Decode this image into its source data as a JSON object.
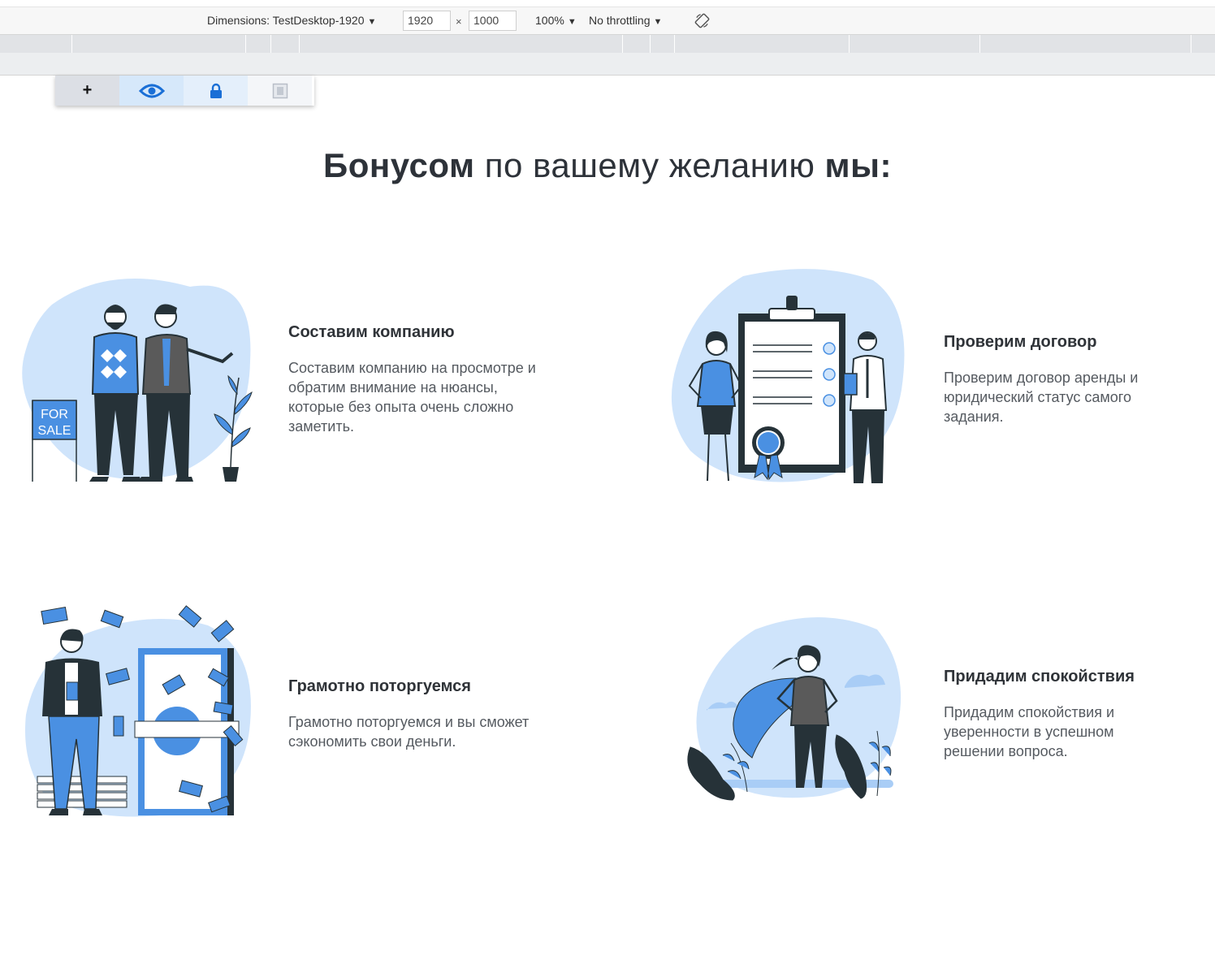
{
  "devtools": {
    "dimensions_label": "Dimensions: TestDesktop-1920",
    "width_value": "1920",
    "height_value": "1000",
    "times": "×",
    "zoom": "100%",
    "throttling": "No throttling",
    "arrow": "▼"
  },
  "floating_panel": {
    "add_label": "+"
  },
  "page": {
    "title_bold1": "Бонусом",
    "title_regular": " по вашему желанию ",
    "title_bold2": "мы:"
  },
  "cards": [
    {
      "title": "Составим компанию",
      "text": "Составим компанию на просмотре и обратим внимание на нюансы, которые без опыта очень сложно заметить."
    },
    {
      "title": "Проверим договор",
      "text": "Проверим договор аренды и юридический статус самого задания."
    },
    {
      "title": "Грамотно поторгуемся",
      "text": "Грамотно поторгуемся и вы сможет сэкономить свои деньги."
    },
    {
      "title": "Придадим спокойствия",
      "text": "Придадим спокойствия и уверенности в успешном решении вопроса."
    }
  ],
  "illustrations": {
    "for_sale_sign_line1": "FOR",
    "for_sale_sign_line2": "SALE"
  },
  "colors": {
    "accent_blue": "#4a90e2",
    "light_blue_blob": "#cfe4fb",
    "dark_figure": "#263238",
    "devtools_bg": "#f7f7f7"
  }
}
